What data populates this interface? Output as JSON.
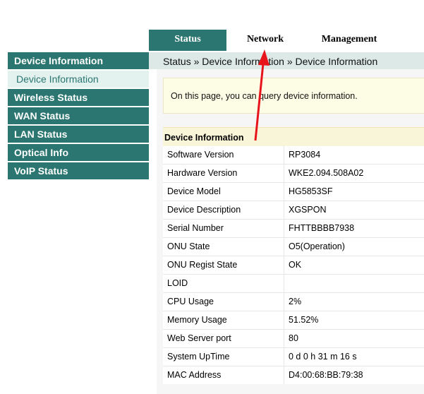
{
  "tabs": [
    "Status",
    "Network",
    "Management"
  ],
  "sidebar": [
    {
      "label": "Device Information",
      "sub": false
    },
    {
      "label": "Device Information",
      "sub": true
    },
    {
      "label": "Wireless Status",
      "sub": false
    },
    {
      "label": "WAN Status",
      "sub": false
    },
    {
      "label": "LAN Status",
      "sub": false
    },
    {
      "label": "Optical Info",
      "sub": false
    },
    {
      "label": "VoIP Status",
      "sub": false
    }
  ],
  "breadcrumb": "Status » Device Information » Device Information",
  "info_text": "On this page, you can query device information.",
  "table": {
    "header": "Device Information",
    "rows": [
      {
        "label": "Software Version",
        "value": "RP3084"
      },
      {
        "label": "Hardware Version",
        "value": "WKE2.094.508A02"
      },
      {
        "label": "Device Model",
        "value": "HG5853SF"
      },
      {
        "label": "Device Description",
        "value": "XGSPON"
      },
      {
        "label": "Serial Number",
        "value": "FHTTBBBB7938"
      },
      {
        "label": "ONU State",
        "value": "O5(Operation)"
      },
      {
        "label": "ONU Regist State",
        "value": "OK"
      },
      {
        "label": "LOID",
        "value": ""
      },
      {
        "label": "CPU Usage",
        "value": "2%"
      },
      {
        "label": "Memory Usage",
        "value": "51.52%"
      },
      {
        "label": "Web Server port",
        "value": "80"
      },
      {
        "label": "System UpTime",
        "value": "0 d 0 h 31 m 16 s"
      },
      {
        "label": "MAC Address",
        "value": "D4:00:68:BB:79:38"
      }
    ]
  },
  "colors": {
    "primary": "#2b7670",
    "annotation_arrow": "#e8141b"
  }
}
